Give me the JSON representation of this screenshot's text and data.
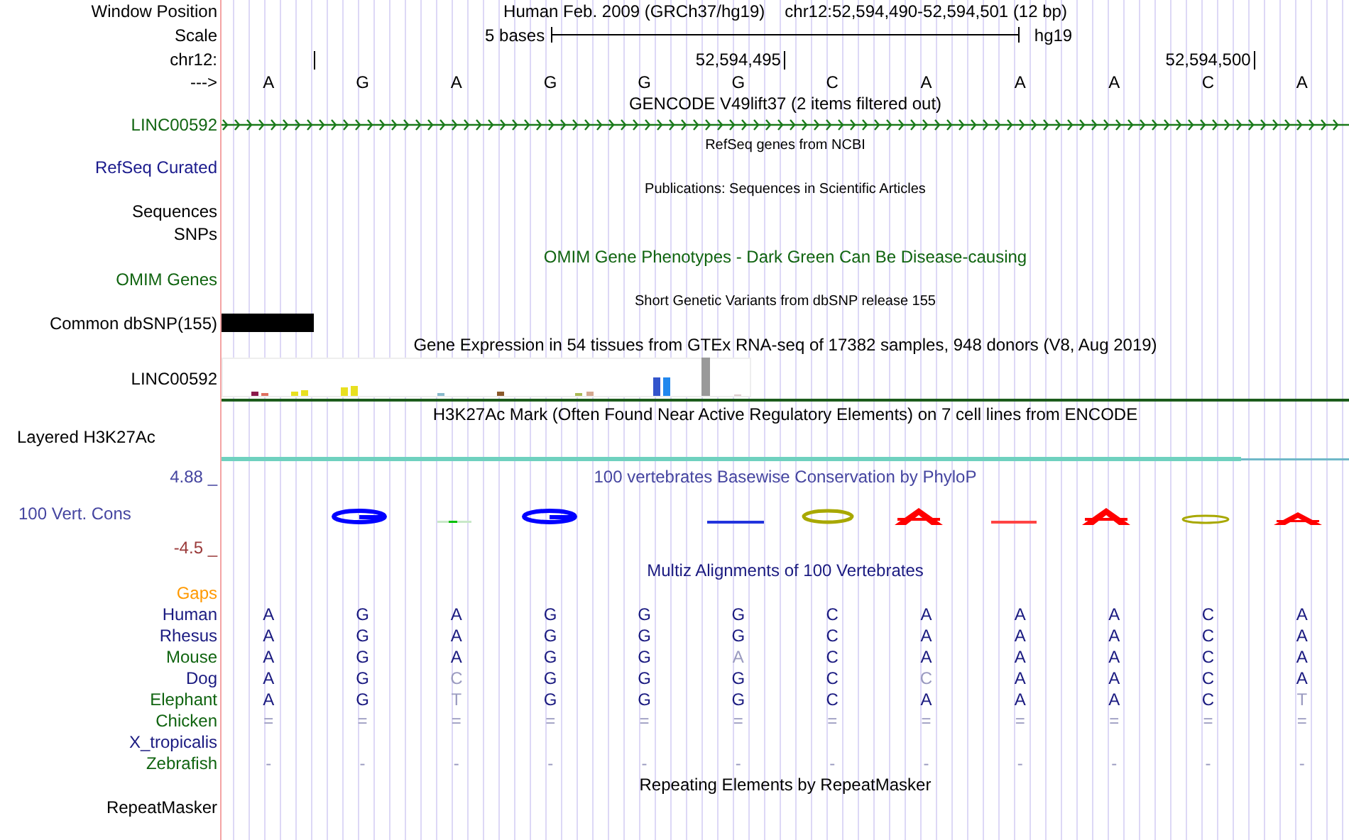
{
  "position": {
    "label": "Window Position",
    "assembly": "Human Feb. 2009 (GRCh37/hg19)",
    "range": "chr12:52,594,490-52,594,501 (12 bp)"
  },
  "scale": {
    "label": "Scale",
    "length": "5 bases",
    "database": "hg19"
  },
  "ruler": {
    "label": "chr12:",
    "tick_labels": [
      "52,594,495",
      "52,594,500"
    ]
  },
  "bases": {
    "label": "--->",
    "letters": [
      "A",
      "G",
      "A",
      "G",
      "G",
      "G",
      "C",
      "A",
      "A",
      "A",
      "C",
      "A"
    ]
  },
  "gencode": {
    "title": "GENCODE V49lift37 (2 items filtered out)",
    "label": "LINC00592"
  },
  "refseq": {
    "title": "RefSeq genes from NCBI",
    "label": "RefSeq Curated"
  },
  "publications": {
    "title": "Publications: Sequences in Scientific Articles",
    "labels": [
      "Sequences",
      "SNPs"
    ]
  },
  "omim": {
    "title": "OMIM Gene Phenotypes - Dark Green Can Be Disease-causing",
    "label": "OMIM Genes"
  },
  "dbsnp": {
    "title": "Short Genetic Variants from dbSNP release 155",
    "label": "Common dbSNP(155)"
  },
  "gtex": {
    "title": "Gene Expression in 54 tissues from GTEx RNA-seq of 17382 samples, 948 donors (V8, Aug 2019)",
    "label": "LINC00592"
  },
  "h3k27ac": {
    "title": "H3K27Ac Mark (Often Found Near Active Regulatory Elements) on 7 cell lines from ENCODE",
    "label": "Layered H3K27Ac"
  },
  "phylop": {
    "title": "100 vertebrates Basewise Conservation by PhyloP",
    "max_label": "4.88 _",
    "label": "100 Vert. Cons",
    "min_label": "-4.5 _"
  },
  "multiz": {
    "title": "Multiz Alignments of 100 Vertebrates",
    "gaps_label": "Gaps",
    "species": [
      {
        "name": "Human",
        "color": "#1a1a80",
        "bases": [
          {
            "base": "A",
            "faded": false
          },
          {
            "base": "G",
            "faded": false
          },
          {
            "base": "A",
            "faded": false
          },
          {
            "base": "G",
            "faded": false
          },
          {
            "base": "G",
            "faded": false
          },
          {
            "base": "G",
            "faded": false
          },
          {
            "base": "C",
            "faded": false
          },
          {
            "base": "A",
            "faded": false
          },
          {
            "base": "A",
            "faded": false
          },
          {
            "base": "A",
            "faded": false
          },
          {
            "base": "C",
            "faded": false
          },
          {
            "base": "A",
            "faded": false
          }
        ]
      },
      {
        "name": "Rhesus",
        "color": "#1a1a80",
        "bases": [
          {
            "base": "A",
            "faded": false
          },
          {
            "base": "G",
            "faded": false
          },
          {
            "base": "A",
            "faded": false
          },
          {
            "base": "G",
            "faded": false
          },
          {
            "base": "G",
            "faded": false
          },
          {
            "base": "G",
            "faded": false
          },
          {
            "base": "C",
            "faded": false
          },
          {
            "base": "A",
            "faded": false
          },
          {
            "base": "A",
            "faded": false
          },
          {
            "base": "A",
            "faded": false
          },
          {
            "base": "C",
            "faded": false
          },
          {
            "base": "A",
            "faded": false
          }
        ]
      },
      {
        "name": "Mouse",
        "color": "#106410",
        "bases": [
          {
            "base": "A",
            "faded": false
          },
          {
            "base": "G",
            "faded": false
          },
          {
            "base": "A",
            "faded": false
          },
          {
            "base": "G",
            "faded": false
          },
          {
            "base": "G",
            "faded": false
          },
          {
            "base": "A",
            "faded": true
          },
          {
            "base": "C",
            "faded": false
          },
          {
            "base": "A",
            "faded": false
          },
          {
            "base": "A",
            "faded": false
          },
          {
            "base": "A",
            "faded": false
          },
          {
            "base": "C",
            "faded": false
          },
          {
            "base": "A",
            "faded": false
          }
        ]
      },
      {
        "name": "Dog",
        "color": "#1a1a80",
        "bases": [
          {
            "base": "A",
            "faded": false
          },
          {
            "base": "G",
            "faded": false
          },
          {
            "base": "C",
            "faded": true
          },
          {
            "base": "G",
            "faded": false
          },
          {
            "base": "G",
            "faded": false
          },
          {
            "base": "G",
            "faded": false
          },
          {
            "base": "C",
            "faded": false
          },
          {
            "base": "C",
            "faded": true
          },
          {
            "base": "A",
            "faded": false
          },
          {
            "base": "A",
            "faded": false
          },
          {
            "base": "C",
            "faded": false
          },
          {
            "base": "A",
            "faded": false
          }
        ]
      },
      {
        "name": "Elephant",
        "color": "#106410",
        "bases": [
          {
            "base": "A",
            "faded": false
          },
          {
            "base": "G",
            "faded": false
          },
          {
            "base": "T",
            "faded": true
          },
          {
            "base": "G",
            "faded": false
          },
          {
            "base": "G",
            "faded": false
          },
          {
            "base": "G",
            "faded": false
          },
          {
            "base": "C",
            "faded": false
          },
          {
            "base": "A",
            "faded": false
          },
          {
            "base": "A",
            "faded": false
          },
          {
            "base": "A",
            "faded": false
          },
          {
            "base": "C",
            "faded": false
          },
          {
            "base": "T",
            "faded": true
          }
        ]
      },
      {
        "name": "Chicken",
        "color": "#106410",
        "bases": [
          {
            "base": "=",
            "faded": true
          },
          {
            "base": "=",
            "faded": true
          },
          {
            "base": "=",
            "faded": true
          },
          {
            "base": "=",
            "faded": true
          },
          {
            "base": "=",
            "faded": true
          },
          {
            "base": "=",
            "faded": true
          },
          {
            "base": "=",
            "faded": true
          },
          {
            "base": "=",
            "faded": true
          },
          {
            "base": "=",
            "faded": true
          },
          {
            "base": "=",
            "faded": true
          },
          {
            "base": "=",
            "faded": true
          },
          {
            "base": "=",
            "faded": true
          }
        ]
      },
      {
        "name": "X_tropicalis",
        "color": "#1a1a80"
      },
      {
        "name": "Zebrafish",
        "color": "#106410",
        "bases": [
          {
            "base": "-",
            "faded": true
          },
          {
            "base": "-",
            "faded": true
          },
          {
            "base": "-",
            "faded": true
          },
          {
            "base": "-",
            "faded": true
          },
          {
            "base": "-",
            "faded": true
          },
          {
            "base": "-",
            "faded": true
          },
          {
            "base": "-",
            "faded": true
          },
          {
            "base": "-",
            "faded": true
          },
          {
            "base": "-",
            "faded": true
          },
          {
            "base": "-",
            "faded": true
          },
          {
            "base": "-",
            "faded": true
          },
          {
            "base": "-",
            "faded": true
          }
        ]
      }
    ]
  },
  "repeatmasker": {
    "title": "Repeating Elements by RepeatMasker",
    "label": "RepeatMasker"
  }
}
